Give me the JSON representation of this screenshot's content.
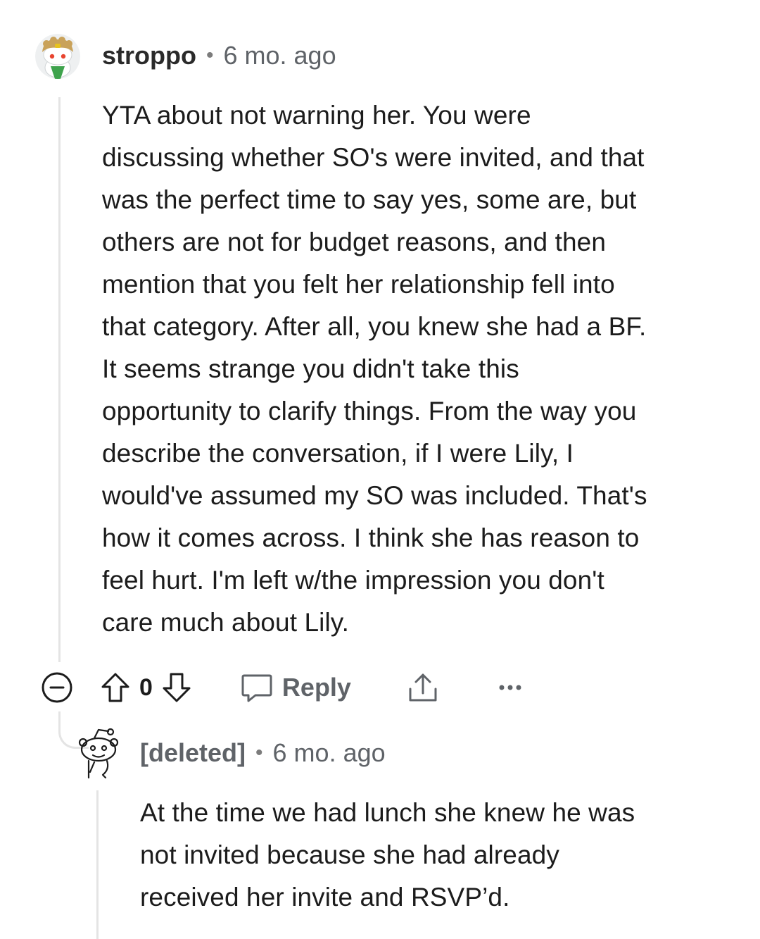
{
  "comments": [
    {
      "username": "stroppo",
      "separator": "•",
      "time": "6 mo. ago",
      "avatar_icon": "snoo-avatar-icon",
      "body": "YTA about not warning her. You were\ndiscussing whether SO's were invited, and that\nwas the perfect time to say yes, some are, but\nothers are not for budget reasons, and then\nmention that you felt her relationship fell into\nthat category. After all, you knew she had a BF.\nIt seems strange you didn't take this\nopportunity to clarify things. From the way you\ndescribe the conversation, if I were Lily, I\nwould've assumed my SO was included. That's\nhow it comes across. I think she has reason to\nfeel hurt. I'm left w/the impression you don't\ncare much about Lily.",
      "actions": {
        "collapse_icon": "collapse-minus-icon",
        "upvote_icon": "upvote-arrow-icon",
        "score": "0",
        "downvote_icon": "downvote-arrow-icon",
        "reply_icon": "speech-bubble-icon",
        "reply_label": "Reply",
        "share_icon": "share-icon",
        "more_icon": "more-dots-icon"
      }
    },
    {
      "username": "[deleted]",
      "separator": "•",
      "time": "6 mo. ago",
      "avatar_icon": "deleted-snoo-icon",
      "body": "At the time we had lunch she knew he was\nnot invited because she had already\nreceived her invite and RSVP’d."
    }
  ],
  "colors": {
    "text": "#1c1c1c",
    "muted": "#5f6368",
    "thread_line": "#e4e4e4",
    "background": "#ffffff"
  }
}
